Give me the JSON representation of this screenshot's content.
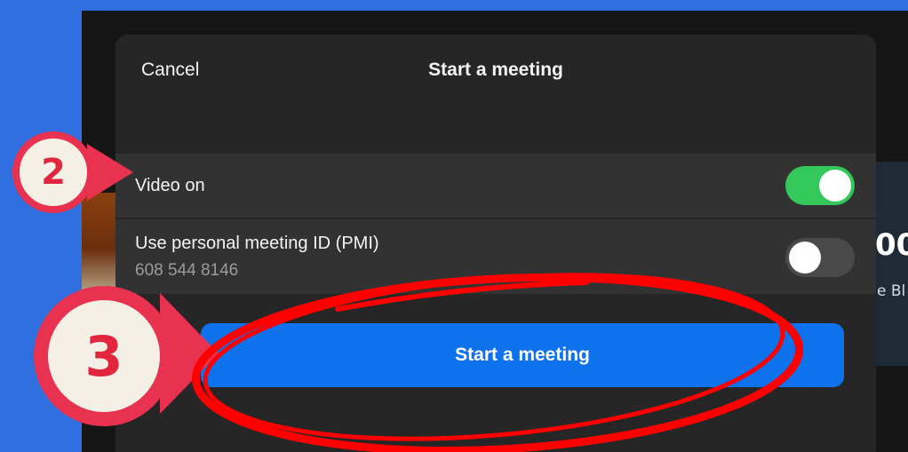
{
  "sheet": {
    "cancel_label": "Cancel",
    "title": "Start a meeting"
  },
  "video_row": {
    "label": "Video on",
    "toggle_on": true
  },
  "pmi_row": {
    "label": "Use personal meeting ID (PMI)",
    "meeting_id": "608 544 8146",
    "toggle_on": false
  },
  "primary_button_label": "Start a meeting",
  "background": {
    "glyph_large": "00",
    "glyph_small": "e Bl"
  },
  "annotations": {
    "step2_label": "2",
    "step3_label": "3",
    "badge_color": "#e8324f",
    "circle_color": "#ff0000"
  },
  "colors": {
    "accent_blue": "#0e72ed",
    "toggle_on": "#34c759",
    "page_background": "#2f6fe0"
  }
}
